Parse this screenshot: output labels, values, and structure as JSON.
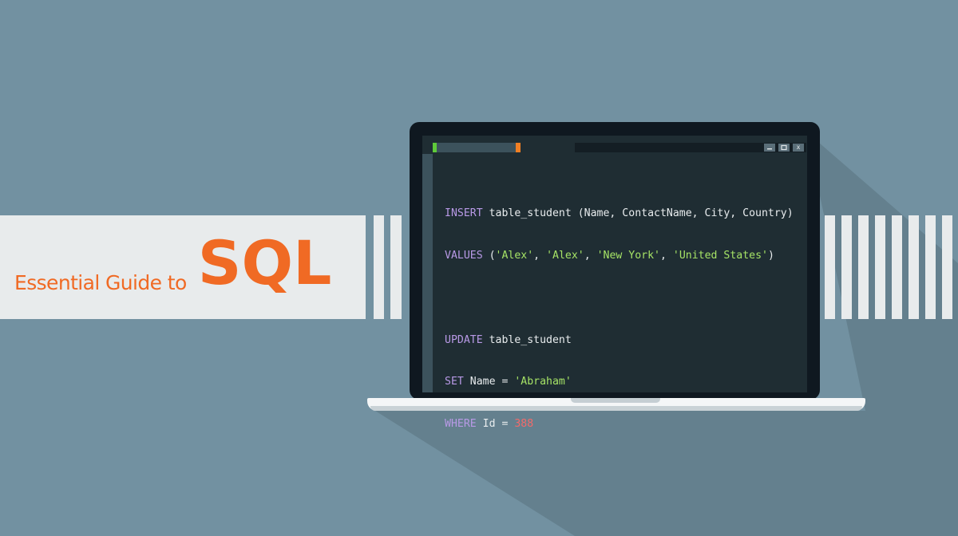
{
  "banner": {
    "subtitle": "Essential Guide to",
    "title": "SQL"
  },
  "editor": {
    "window_buttons": {
      "minimize": "",
      "maximize": "",
      "close": "x"
    },
    "code": {
      "line1": {
        "kw": "INSERT",
        "rest": " table_student (Name, ContactName, City, Country)"
      },
      "line2": {
        "kw": "VALUES",
        "open": " (",
        "s1": "'Alex'",
        "sep1": ", ",
        "s2": "'Alex'",
        "sep2": ", ",
        "s3": "'New York'",
        "sep3": ", ",
        "s4": "'United States'",
        "close": ")"
      },
      "line4": {
        "kw": "UPDATE",
        "rest": " table_student"
      },
      "line5": {
        "kw": "SET",
        "rest": " Name = ",
        "str": "'Abraham'"
      },
      "line6": {
        "kw": "WHERE",
        "rest": " Id = ",
        "num": "388"
      }
    }
  },
  "colors": {
    "background": "#7291a1",
    "banner": "#e8ebec",
    "accent": "#f06a24",
    "screen": "#1f2d33",
    "keyword": "#b899e6",
    "string": "#a6e366",
    "number": "#f36a6a"
  }
}
